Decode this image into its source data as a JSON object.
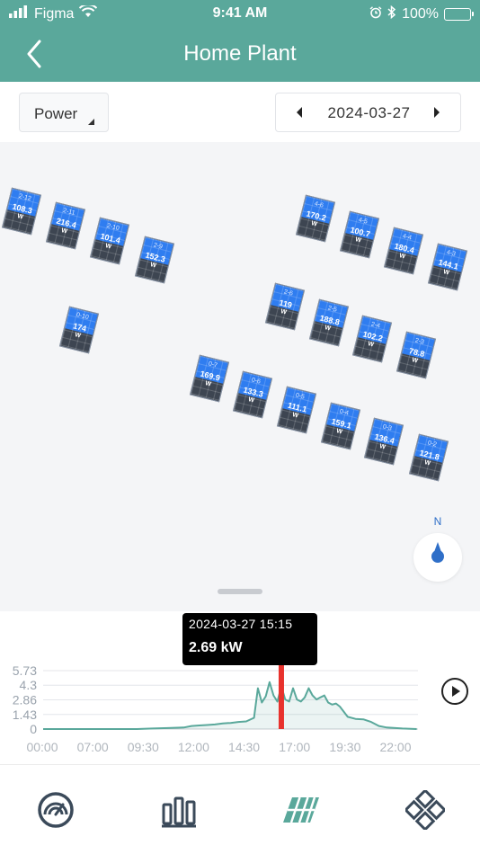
{
  "status_bar": {
    "carrier": "Figma",
    "time": "9:41 AM",
    "battery": "100%"
  },
  "nav": {
    "title": "Home Plant"
  },
  "controls": {
    "metric": "Power",
    "date": "2024-03-27"
  },
  "panels": [
    {
      "id": "2-12",
      "value": "108.3",
      "unit": "W"
    },
    {
      "id": "2-11",
      "value": "216.4",
      "unit": "W"
    },
    {
      "id": "2-10",
      "value": "101.4",
      "unit": "W"
    },
    {
      "id": "2-9",
      "value": "152.3",
      "unit": "W"
    },
    {
      "id": "0-10",
      "value": "174",
      "unit": "W"
    },
    {
      "id": "4-6",
      "value": "170.2",
      "unit": "W"
    },
    {
      "id": "4-5",
      "value": "100.7",
      "unit": "W"
    },
    {
      "id": "4-4",
      "value": "180.4",
      "unit": "W"
    },
    {
      "id": "4-3",
      "value": "144.1",
      "unit": "W"
    },
    {
      "id": "2-6",
      "value": "119",
      "unit": "W"
    },
    {
      "id": "2-5",
      "value": "188.8",
      "unit": "W"
    },
    {
      "id": "2-4",
      "value": "102.2",
      "unit": "W"
    },
    {
      "id": "2-3",
      "value": "78.8",
      "unit": "W"
    },
    {
      "id": "0-7",
      "value": "169.9",
      "unit": "W"
    },
    {
      "id": "0-6",
      "value": "133.3",
      "unit": "W"
    },
    {
      "id": "0-5",
      "value": "111.1",
      "unit": "W"
    },
    {
      "id": "0-4",
      "value": "159.1",
      "unit": "W"
    },
    {
      "id": "0-3",
      "value": "136.4",
      "unit": "W"
    },
    {
      "id": "0-2",
      "value": "121.8",
      "unit": "W"
    }
  ],
  "compass": {
    "label": "N"
  },
  "tooltip": {
    "time": "2024-03-27 15:15",
    "value": "2.69 kW"
  },
  "colors": {
    "header": "#5aa89b",
    "panel_top": "#2f7df0",
    "panel_body": "#3d4551",
    "line": "#5aa89b",
    "marker": "#e8322d",
    "compass_dot": "#2f6fc8"
  },
  "icons": {
    "tab_1": "speedometer-icon",
    "tab_2": "bar-chart-icon",
    "tab_3": "solar-panel-icon",
    "tab_4": "diamond-grid-icon"
  },
  "chart_data": {
    "type": "area",
    "title": "",
    "xlabel": "",
    "ylabel": "",
    "unit": "kW",
    "ylim": [
      0,
      5.73
    ],
    "y_ticks": [
      "5.73",
      "4.3",
      "2.86",
      "1.43",
      "0"
    ],
    "x_ticks": [
      "00:00",
      "07:00",
      "09:30",
      "12:00",
      "14:30",
      "17:00",
      "19:30",
      "22:00"
    ],
    "selected_x": "15:15",
    "series": [
      {
        "name": "",
        "x": [
          0,
          6,
          7,
          8,
          9,
          9.5,
          10,
          10.5,
          11,
          11.5,
          12,
          12.5,
          13,
          13.5,
          13.75,
          14,
          14.25,
          14.5,
          14.75,
          15,
          15.25,
          15.5,
          15.75,
          16,
          16.25,
          16.5,
          16.75,
          17,
          17.25,
          17.5,
          17.75,
          18,
          18.25,
          18.5,
          18.75,
          19,
          19.5,
          20,
          20.5,
          21,
          21.5,
          22,
          23,
          23.92
        ],
        "values": [
          0,
          0,
          0.05,
          0.1,
          0.15,
          0.3,
          0.35,
          0.4,
          0.45,
          0.55,
          0.6,
          0.7,
          0.75,
          1.1,
          4.0,
          2.6,
          3.2,
          4.6,
          3.3,
          2.69,
          4.2,
          2.9,
          2.7,
          4.0,
          2.9,
          2.7,
          3.1,
          4.0,
          3.3,
          2.9,
          3.1,
          3.3,
          2.6,
          2.4,
          2.5,
          2.2,
          1.2,
          1.0,
          0.95,
          0.7,
          0.3,
          0.15,
          0.05,
          0
        ]
      }
    ]
  }
}
